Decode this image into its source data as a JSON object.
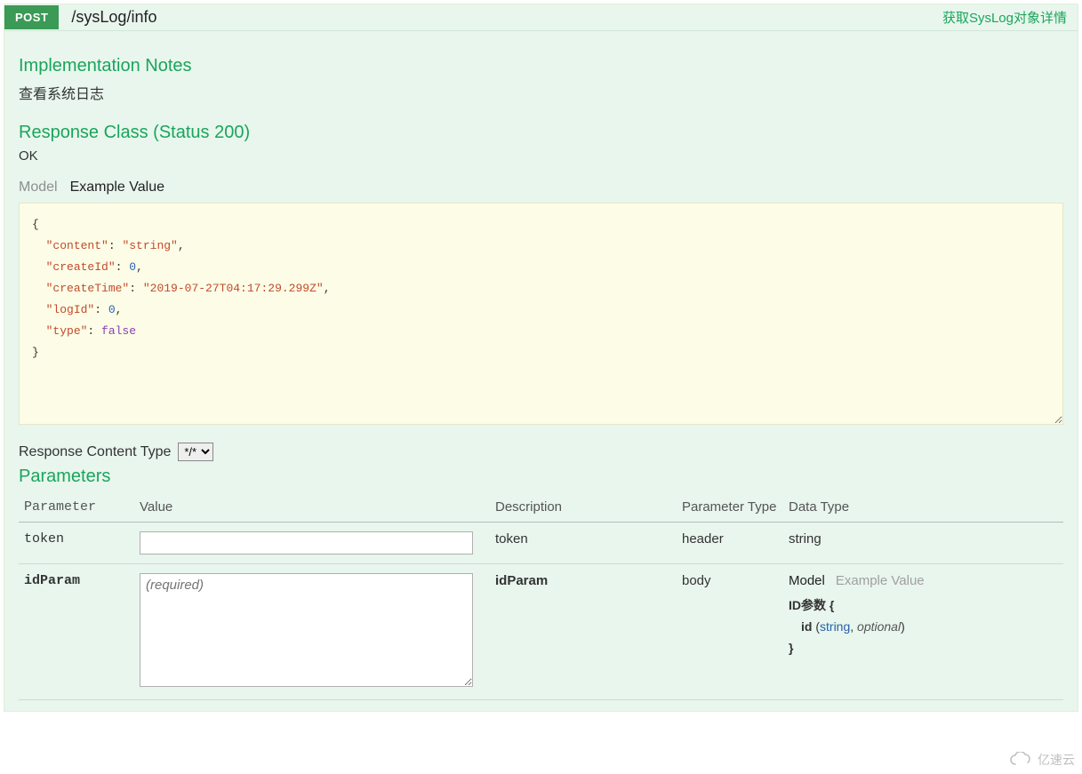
{
  "header": {
    "method": "POST",
    "path": "/sysLog/info",
    "summary": "获取SysLog对象详情"
  },
  "impl_notes": {
    "title": "Implementation Notes",
    "text": "查看系统日志"
  },
  "response_class": {
    "title": "Response Class (Status 200)",
    "status": "OK",
    "tabs": {
      "model": "Model",
      "example": "Example Value"
    },
    "example_json": {
      "content": "string",
      "createId": 0,
      "createTime": "2019-07-27T04:17:29.299Z",
      "logId": 0,
      "type": false
    }
  },
  "response_content_type": {
    "label": "Response Content Type",
    "value": "*/*"
  },
  "parameters": {
    "title": "Parameters",
    "columns": {
      "param": "Parameter",
      "value": "Value",
      "desc": "Description",
      "ptype": "Parameter Type",
      "dtype": "Data Type"
    },
    "rows": [
      {
        "name": "token",
        "required": false,
        "value": "",
        "desc": "token",
        "ptype": "header",
        "dtype": {
          "simple": "string"
        }
      },
      {
        "name": "idParam",
        "required": true,
        "placeholder": "(required)",
        "desc": "idParam",
        "ptype": "body",
        "dtype": {
          "tabs": {
            "model": "Model",
            "example": "Example Value"
          },
          "model": {
            "name": "ID参数",
            "field_name": "id",
            "field_type": "string",
            "field_opt": "optional"
          }
        }
      }
    ]
  },
  "watermark": "亿速云"
}
